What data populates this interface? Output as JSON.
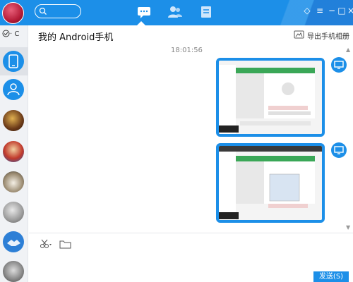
{
  "header": {
    "title": "我的 Android手机",
    "export_label": "导出手机相册"
  },
  "sidebar": {
    "status_label": "· C"
  },
  "chat": {
    "timestamp": "18:01:56",
    "images": [
      {
        "description": "screenshot-1"
      },
      {
        "description": "screenshot-2"
      }
    ]
  },
  "composer": {
    "send_label": "发送(S)"
  },
  "colors": {
    "accent": "#1c8fe8"
  },
  "icons": [
    "search-icon",
    "chat-icon",
    "contacts-icon",
    "files-icon",
    "minimize-icon",
    "close-icon",
    "skin-icon",
    "menu-icon",
    "phone-icon",
    "scissors-icon",
    "folder-icon",
    "computer-icon"
  ]
}
